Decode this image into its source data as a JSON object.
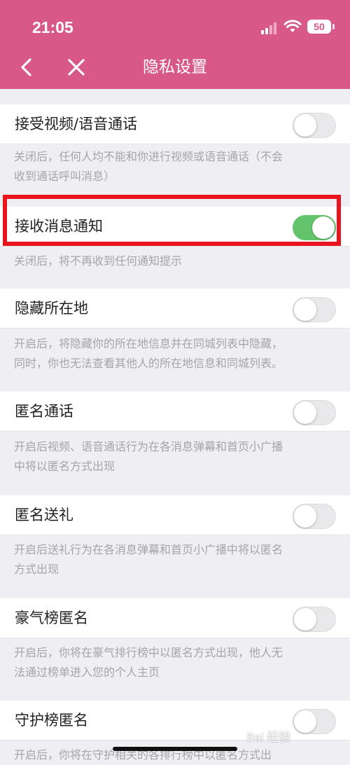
{
  "status_bar": {
    "time": "21:05",
    "battery": "50"
  },
  "nav": {
    "title": "隐私设置",
    "back_icon": "chevron-left-icon",
    "close_icon": "close-icon"
  },
  "settings": [
    {
      "label": "接受视频/语音通话",
      "on": false,
      "desc_lines": [
        "关闭后，任何人均不能和你进行视频或语音通话（不会",
        "收到通话呼叫消息）"
      ]
    },
    {
      "label": "接收消息通知",
      "on": true,
      "desc_lines": [
        "关闭后，将不再收到任何通知提示"
      ]
    },
    {
      "label": "隐藏所在地",
      "on": false,
      "desc_lines": [
        "开启后，将隐藏你的所在地信息并在同城列表中隐藏，",
        "同时，你也无法查看其他人的所在地信息和同城列表。"
      ]
    },
    {
      "label": "匿名通话",
      "on": false,
      "desc_lines": [
        "开启后视频、语音通话行为在各消息弹幕和首页小广播",
        "中将以匿名方式出现"
      ]
    },
    {
      "label": "匿名送礼",
      "on": false,
      "desc_lines": [
        "开启后送礼行为在各消息弹幕和首页小广播中将以匿名",
        "方式出现"
      ]
    },
    {
      "label": "豪气榜匿名",
      "on": false,
      "desc_lines": [
        "开启后，你将在豪气排行榜中以匿名方式出现，他人无",
        "法通过榜单进入您的个人主页"
      ]
    },
    {
      "label": "守护榜匿名",
      "on": false,
      "desc_lines": [
        "开启后，你将在守护相关的各排行榜中以匿名方式出"
      ]
    }
  ],
  "watermark": "Bai 经验",
  "colors": {
    "header": "#d85888",
    "toggle_on": "#63c46c",
    "highlight": "#e8141e"
  }
}
